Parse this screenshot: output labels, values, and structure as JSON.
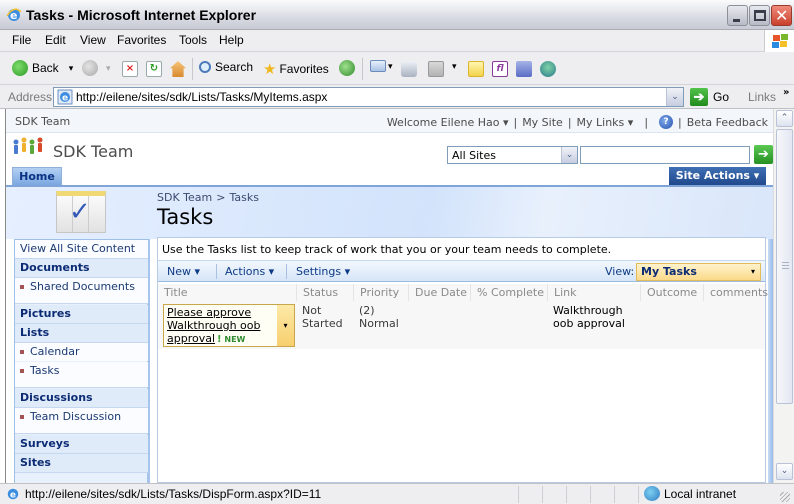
{
  "window": {
    "title": "Tasks - Microsoft Internet Explorer",
    "min_label": "_",
    "close_label": "✕"
  },
  "menubar": [
    "File",
    "Edit",
    "View",
    "Favorites",
    "Tools",
    "Help"
  ],
  "toolbar": {
    "back": "Back",
    "search": "Search",
    "favorites": "Favorites",
    "dropdown_glyph": "▾"
  },
  "address": {
    "label": "Address",
    "url": "http://eilene/sites/sdk/Lists/Tasks/MyItems.aspx",
    "go": "Go",
    "go_glyph": "➔",
    "links": "Links",
    "more": "»",
    "dropdown_glyph": "⌄"
  },
  "sharepoint": {
    "top_site": "SDK Team",
    "welcome": "Welcome Eilene Hao ▾",
    "my_site": "My Site",
    "my_links": "My Links ▾",
    "separator": "|",
    "help_glyph": "?",
    "beta_feedback": "Beta Feedback",
    "site_title": "SDK Team",
    "search_scope": "All Sites",
    "search_value": "",
    "search_go_glyph": "➔",
    "home_tab": "Home",
    "site_actions": "Site Actions ▾",
    "breadcrumb": [
      "SDK Team",
      ">",
      "Tasks"
    ],
    "page_title": "Tasks",
    "check_glyph": "✓"
  },
  "leftnav": {
    "view_all": "View All Site Content",
    "sections": [
      {
        "header": "Documents",
        "items": [
          "Shared Documents"
        ]
      },
      {
        "header": "Pictures",
        "items": []
      },
      {
        "header": "Lists",
        "items": [
          "Calendar",
          "Tasks"
        ]
      },
      {
        "header": "Discussions",
        "items": [
          "Team Discussion"
        ]
      },
      {
        "header": "Surveys",
        "items": []
      },
      {
        "header": "Sites",
        "items": []
      }
    ]
  },
  "list": {
    "description": "Use the Tasks list to keep track of work that you or your team needs to complete.",
    "toolbar": {
      "new": "New ▾",
      "actions": "Actions ▾",
      "settings": "Settings ▾"
    },
    "view_label": "View:",
    "view_value": "My Tasks",
    "view_dropdown_glyph": "▾",
    "columns": [
      "Title",
      "Status",
      "Priority",
      "Due Date",
      "% Complete",
      "Link",
      "Outcome",
      "comments"
    ],
    "rows": [
      {
        "title_lines": [
          "Please approve",
          "Walkthrough oob",
          "approval"
        ],
        "new_badge": "NEW",
        "new_glyph": "!",
        "menu_glyph": "▾",
        "status": [
          "Not",
          "Started"
        ],
        "priority": [
          "(2)",
          "Normal"
        ],
        "due_date": "",
        "percent_complete": "",
        "link": [
          "Walkthrough",
          "oob approval"
        ],
        "outcome": "",
        "comments": ""
      }
    ]
  },
  "scrollbar": {
    "up": "⌃",
    "down": "⌄"
  },
  "statusbar": {
    "text": "http://eilene/sites/sdk/Lists/Tasks/DispForm.aspx?ID=11",
    "zone": "Local intranet"
  }
}
